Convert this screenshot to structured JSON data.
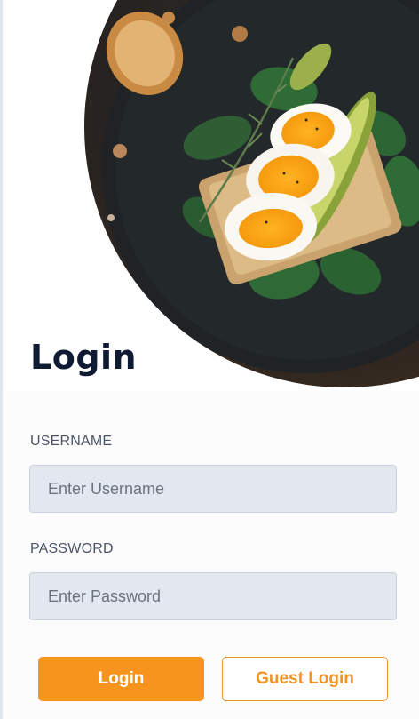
{
  "hero": {
    "image": "eggs-avocado-toast-photo"
  },
  "login": {
    "title": "Login",
    "username_label": "USERNAME",
    "username_placeholder": "Enter Username",
    "password_label": "PASSWORD",
    "password_placeholder": "Enter Password",
    "login_button": "Login",
    "guest_button": "Guest Login"
  },
  "colors": {
    "accent": "#f7941d",
    "title": "#0f1b33",
    "input_bg": "#e3e8f0"
  }
}
